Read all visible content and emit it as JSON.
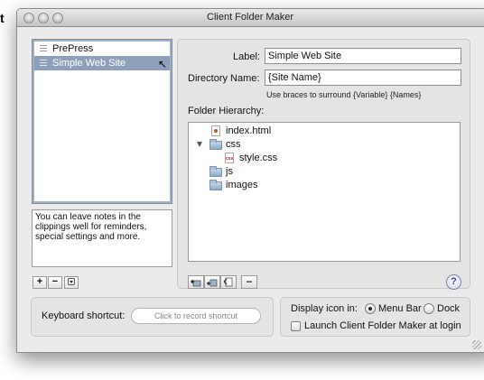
{
  "background": {
    "fragment": "t"
  },
  "window": {
    "title": "Client Folder Maker"
  },
  "clippings": {
    "items": [
      {
        "label": "PrePress",
        "selected": false
      },
      {
        "label": "Simple Web Site",
        "selected": true
      }
    ],
    "notes": "You can leave notes in the clippings well for reminders, special settings and more."
  },
  "list_buttons": {
    "add": "+",
    "remove": "−"
  },
  "form": {
    "label_caption": "Label:",
    "label_value": "Simple Web Site",
    "directory_caption": "Directory Name:",
    "directory_value": "{Site Name}",
    "hint": "Use braces to surround {Variable} {Names}",
    "hierarchy_caption": "Folder Hierarchy:"
  },
  "hierarchy": {
    "nodes": [
      {
        "label": "index.html",
        "icon": "html-file-icon"
      },
      {
        "label": "css",
        "icon": "folder-icon",
        "expanded": true
      },
      {
        "label": "style.css",
        "icon": "css-file-icon"
      },
      {
        "label": "js",
        "icon": "folder-icon"
      },
      {
        "label": "images",
        "icon": "folder-icon"
      }
    ],
    "css_badge": "css"
  },
  "tree_tools": {
    "remove": "−",
    "help": "?"
  },
  "shortcut": {
    "caption": "Keyboard shortcut:",
    "placeholder": "Click to record shortcut"
  },
  "display": {
    "caption": "Display icon in:",
    "option_menubar": "Menu Bar",
    "option_dock": "Dock",
    "selected": "Menu Bar",
    "launch_label": "Launch Client Folder Maker at login",
    "launch_checked": false
  }
}
